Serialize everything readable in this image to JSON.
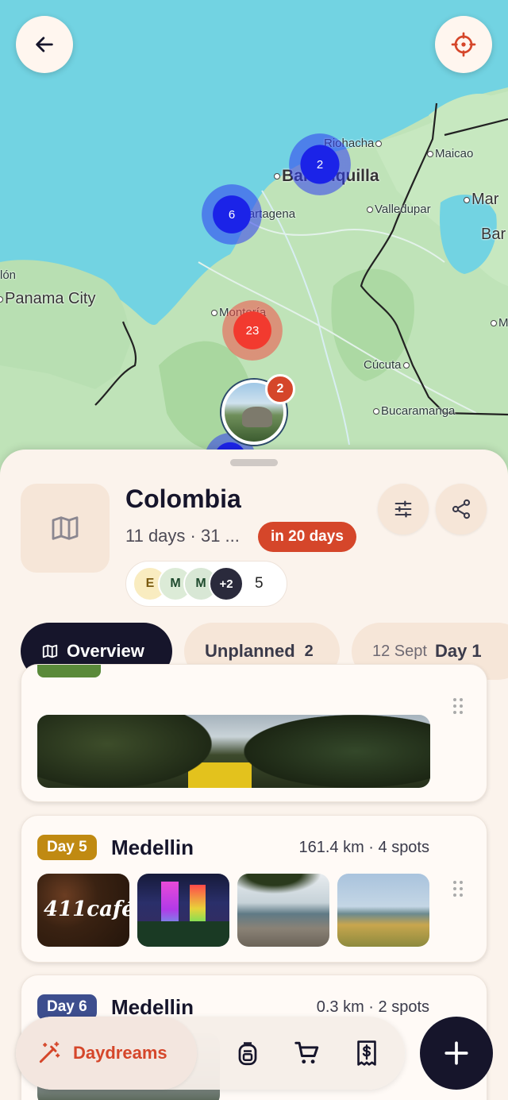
{
  "map": {
    "places": {
      "riohacha": "Riohacha",
      "maicao": "Maicao",
      "barranquilla": "Barranquilla",
      "cartagena": "Cartagena",
      "valledupar": "Valledupar",
      "mar": "Mar",
      "bar": "Bar",
      "lon": "lón",
      "panama": "Panama City",
      "monteria": "Montería",
      "cucuta": "Cúcuta",
      "bucaramanga": "Bucaramanga",
      "om": "M"
    },
    "clusters": {
      "barranquilla": "2",
      "cartagena": "6",
      "monteria": "23"
    },
    "photo_pin_badge": "2",
    "icons": {
      "back": "arrow-left-icon",
      "locate": "crosshair-icon"
    }
  },
  "trip": {
    "title": "Colombia",
    "meta": "11 days · 31 ...",
    "when": "in 20 days",
    "members": [
      "E",
      "M",
      "M"
    ],
    "members_more": "+2",
    "members_count": "5"
  },
  "tabs": {
    "overview": "Overview",
    "unplanned": "Unplanned",
    "unplanned_count": "2",
    "day1_date": "12 Sept",
    "day1": "Day 1"
  },
  "days": [
    {
      "badge": "Day 5",
      "city": "Medellin",
      "stats": "161.4 km · 4 spots",
      "photo_caption": "411café",
      "badge_color": "#c08a12"
    },
    {
      "badge": "Day 6",
      "city": "Medellin",
      "stats": "0.3 km · 2 spots",
      "badge_color": "#3d4e8e"
    }
  ],
  "bottom": {
    "daydreams": "Daydreams",
    "icons": [
      "wand-icon",
      "backpack-icon",
      "cart-icon",
      "receipt-icon",
      "plus-icon"
    ]
  },
  "colors": {
    "accent": "#d5462a",
    "dark": "#16152b",
    "sheet": "#fbf3ec"
  }
}
